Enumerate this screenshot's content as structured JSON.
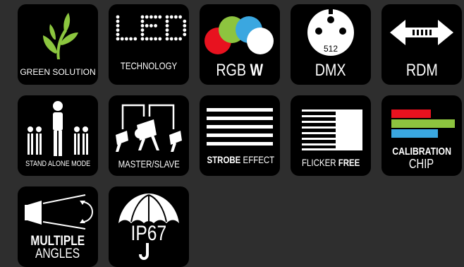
{
  "icons": {
    "green_solution": {
      "label": "GREEN SOLUTION",
      "icon": "leaf-sprout-icon",
      "color": "#8cc63f"
    },
    "led": {
      "word": "LED",
      "label": "TECHNOLOGY",
      "icon": "led-dot-letters-icon"
    },
    "rgbw": {
      "label_main": "RGB",
      "label_bold": "W",
      "icon": "color-circles-icon",
      "colors": {
        "red": "#e8121f",
        "green": "#8dc43f",
        "blue": "#3aa7e0",
        "white": "#ffffff"
      }
    },
    "dmx": {
      "connector_text": "512",
      "label": "DMX",
      "icon": "xlr-connector-icon"
    },
    "rdm": {
      "label": "RDM",
      "icon": "bidirectional-arrow-icon"
    },
    "stand_alone": {
      "label": "STAND ALONE MODE",
      "icon": "person-group-icon"
    },
    "master_slave": {
      "label": "MASTER/SLAVE",
      "icon": "linked-spotlights-icon"
    },
    "strobe": {
      "label_bold": "STROBE",
      "label_rest": " EFFECT",
      "icon": "strobe-lines-icon"
    },
    "flicker_free": {
      "label_main": "FLICKER ",
      "label_bold": "FREE",
      "icon": "flicker-gradient-icon"
    },
    "calibration": {
      "label_line1": "CALIBRATION",
      "label_line2": "CHIP",
      "icon": "calibration-bars-icon",
      "colors": {
        "red": "#e8121f",
        "green": "#8dc43f",
        "blue": "#3aa7e0"
      }
    },
    "multiple_angles": {
      "label_line1": "MULTIPLE",
      "label_line2": "ANGLES",
      "icon": "beam-angle-icon"
    },
    "ip67": {
      "label": "IP67",
      "icon": "umbrella-icon"
    }
  }
}
